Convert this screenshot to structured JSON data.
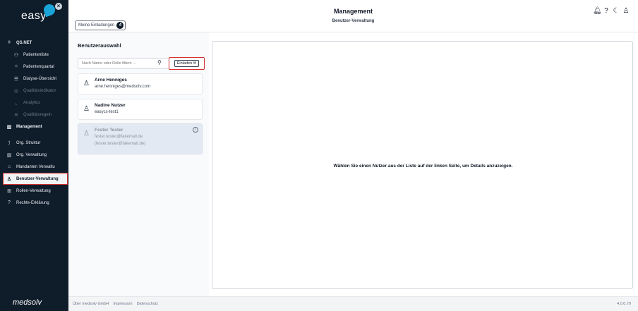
{
  "brand": {
    "logo_text": "easy",
    "footer_logo": "medsolv"
  },
  "sidebar": {
    "items": [
      {
        "label": "QS.NET",
        "icon": "qs-net-icon",
        "glyph": "⁽⁾"
      },
      {
        "label": "Patientenliste",
        "icon": "users-icon",
        "glyph": "⚇"
      },
      {
        "label": "Patientenquartal",
        "icon": "qs-net-icon",
        "glyph": "⁽⁾"
      },
      {
        "label": "Dialyse-Übersicht",
        "icon": "list-icon",
        "glyph": "☰"
      },
      {
        "label": "Qualitätsindikator",
        "icon": "check-circle-icon",
        "glyph": "◎"
      },
      {
        "label": "Analytics",
        "icon": "chart-icon",
        "glyph": "⌞"
      },
      {
        "label": "Qualitätsregeln",
        "icon": "rules-icon",
        "glyph": "≋"
      },
      {
        "label": "Management",
        "icon": "building-icon",
        "glyph": "▥"
      },
      {
        "label": "Org. Struktur",
        "icon": "org-structure-icon",
        "glyph": "ℐ"
      },
      {
        "label": "Org. Verwaltung",
        "icon": "building-icon",
        "glyph": "▥"
      },
      {
        "label": "Mandanten Verwaltu",
        "icon": "home-icon",
        "glyph": "⌂"
      },
      {
        "label": "Benutzer-Verwaltung",
        "icon": "user-icon",
        "glyph": "♙"
      },
      {
        "label": "Rollen-Verwaltung",
        "icon": "roles-icon",
        "glyph": "⊞"
      },
      {
        "label": "Rechte-Erklärung",
        "icon": "help-icon",
        "glyph": "?"
      }
    ]
  },
  "header": {
    "invitations_label": "Meine Einladungen",
    "invitations_count": "4",
    "title": "Management",
    "subtitle": "Benutzer-Verwaltung",
    "icons": [
      "bell-icon",
      "help-icon",
      "moon-icon",
      "user-icon"
    ]
  },
  "left_panel": {
    "title": "Benutzerauswahl",
    "search_placeholder": "Nach Name oder Rolle filtern ...",
    "invite_button": "Einladen ✉",
    "users": [
      {
        "name": "Arne Henniges",
        "email": "arne.henniges@medsolv.com"
      },
      {
        "name": "Nadine Nutzer",
        "email": "easycs-test1"
      },
      {
        "name": "Fester Tester",
        "email": "fester.tester@fakemail.de",
        "email2": "(fester.tester@fakemail.de)"
      }
    ]
  },
  "right_panel": {
    "empty_message": "Wählen Sie einen Nutzer aus der Liste auf der linken Seite, um Details anzuzeigen."
  },
  "footer": {
    "links": [
      "Über medsolv GmbH",
      "Impressum",
      "Datenschutz"
    ],
    "version": "4.0.0.79"
  }
}
